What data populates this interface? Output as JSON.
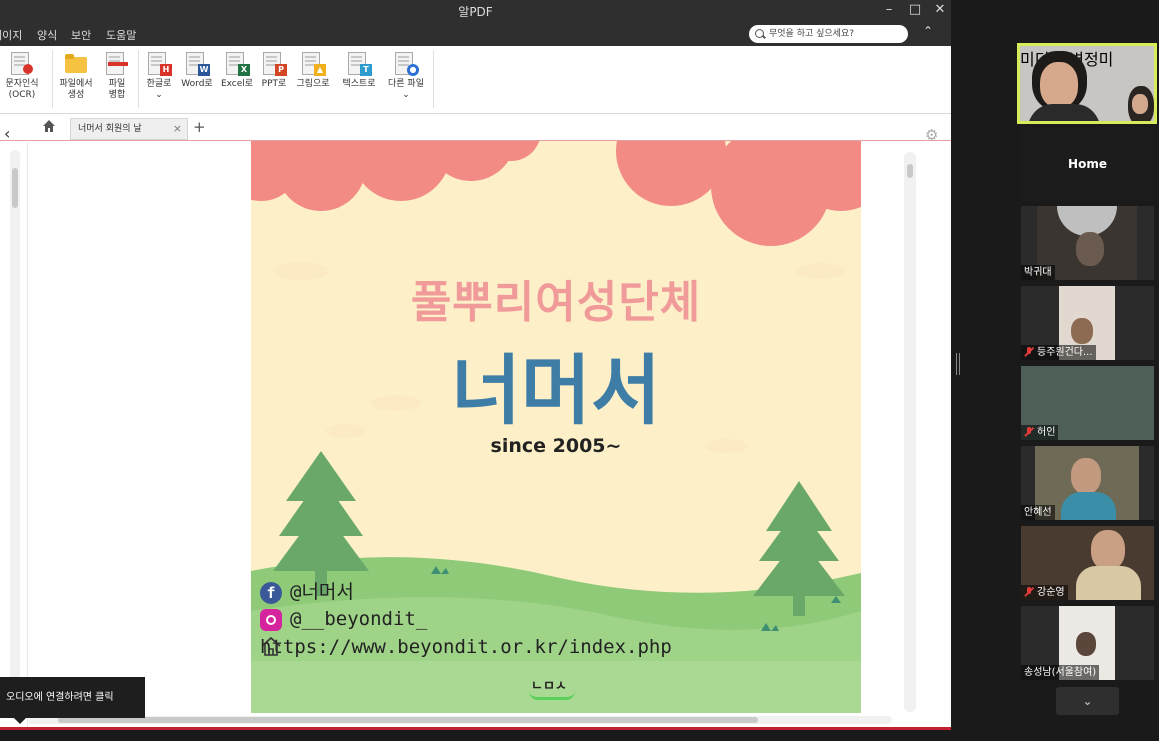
{
  "app": {
    "title": "알PDF",
    "window_controls": {
      "minimize": "–",
      "maximize": "□",
      "close": "✕"
    },
    "menu": [
      "페이지",
      "양식",
      "보안",
      "도움말"
    ],
    "search_placeholder": "무엇을 하고 싶으세요?",
    "collapse_icon": "chevron-up"
  },
  "ribbon": [
    {
      "line1": "문자인식",
      "line2": "(OCR)",
      "icon": "ocr-icon"
    },
    {
      "line1": "파일에서",
      "line2": "생성",
      "icon": "folder-icon"
    },
    {
      "line1": "파일",
      "line2": "병합",
      "icon": "merge-icon"
    },
    {
      "line1": "한글로",
      "line2": "⌄",
      "icon": "hwp-icon",
      "badge": "H",
      "color": "#d9342b"
    },
    {
      "line1": "Word로",
      "line2": "",
      "icon": "word-icon",
      "badge": "W",
      "color": "#2b579a"
    },
    {
      "line1": "Excel로",
      "line2": "",
      "icon": "excel-icon",
      "badge": "X",
      "color": "#217346"
    },
    {
      "line1": "PPT로",
      "line2": "",
      "icon": "ppt-icon",
      "badge": "P",
      "color": "#d24726"
    },
    {
      "line1": "그림으로",
      "line2": "",
      "icon": "image-icon",
      "badge": "▲",
      "color": "#f2b01e"
    },
    {
      "line1": "텍스트로",
      "line2": "",
      "icon": "text-icon",
      "badge": "T",
      "color": "#2e9ccf"
    },
    {
      "line1": "다른 파일",
      "line2": "⌄",
      "icon": "other-file-icon",
      "badge": "●",
      "color": "#2b6fd6"
    }
  ],
  "tabs": {
    "doc_tab": "너머서 회원의 날",
    "close": "×",
    "add": "+"
  },
  "poster": {
    "subtitle": "풀뿌리여성단체",
    "title": "너머서",
    "since": "since 2005~",
    "facebook": "@너머서",
    "instagram": "@__beyondit_",
    "website": "https://www.beyondit.or.kr/index.php",
    "logo": "ㄴㅁㅅ"
  },
  "audio_tooltip": "오디오에 연결하려면 클릭",
  "gallery": {
    "participants": [
      {
        "name": "미디어 변정미",
        "muted": false
      },
      {
        "name": "박귀대",
        "muted": false
      },
      {
        "name": "등주원건다...",
        "muted": true
      },
      {
        "name": "허인",
        "muted": true
      },
      {
        "name": "안혜선",
        "muted": false
      },
      {
        "name": "강순영",
        "muted": true
      },
      {
        "name": "송성남(서울참여)",
        "muted": false
      }
    ],
    "home_label": "Home",
    "down_icon": "⌄"
  },
  "colors": {
    "accent_red": "#c02030",
    "active_speaker": "#d8ec5a",
    "poster_pink": "#f09a9a",
    "poster_blue": "#3e7ea6"
  }
}
